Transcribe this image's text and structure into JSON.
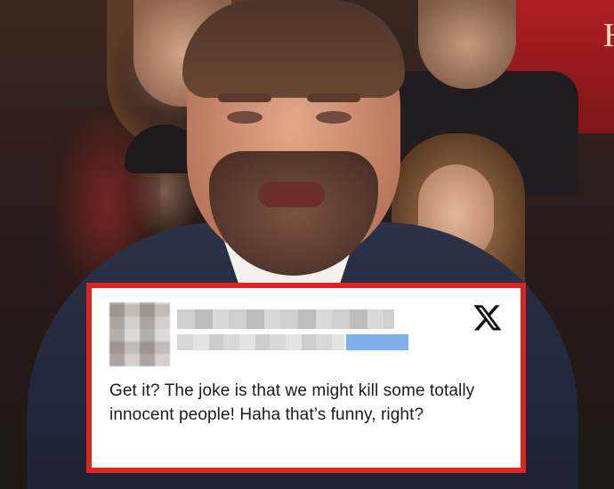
{
  "tweet": {
    "text": "Get it? The joke is that we might kill some totally innocent people! Haha that’s funny, right?",
    "platform_icon": "x-logo-icon",
    "border_color": "#e0231f"
  },
  "background": {
    "shirt_lettering": "H"
  }
}
